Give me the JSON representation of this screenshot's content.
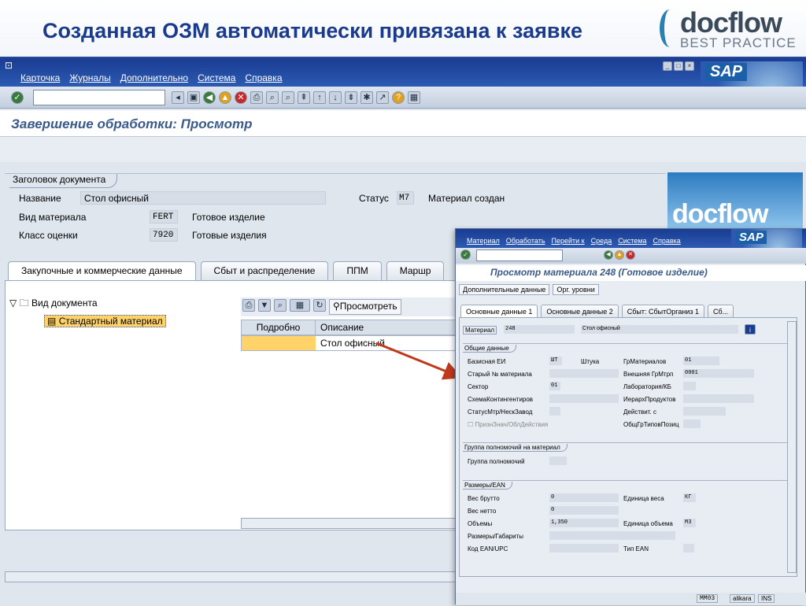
{
  "slide": {
    "title": "Созданная ОЗМ автоматически привязана к заявке",
    "logo_word": "docflow",
    "logo_sub": "BEST PRACTICE"
  },
  "sap": {
    "menu": [
      "Карточка",
      "Журналы",
      "Дополнительно",
      "Система",
      "Справка"
    ],
    "title": "Завершение обработки: Просмотр",
    "header_group": "Заголовок документа",
    "name_label": "Название",
    "name_value": "Стол офисный",
    "status_label": "Статус",
    "status_code": "M7",
    "status_text": "Материал создан",
    "type_label": "Вид материала",
    "type_code": "FERT",
    "type_text": "Готовое изделие",
    "class_label": "Класс оценки",
    "class_code": "7920",
    "class_text": "Готовые изделия",
    "docflow_img": "docflow",
    "tabs": [
      "Закупочные и коммерческие данные",
      "Сбыт и распределение",
      "ППМ",
      "Маршр"
    ],
    "tree_root": "Вид документа",
    "tree_child": "Стандартный материал",
    "alv_view": "Просмотреть",
    "alv_cols": [
      "Подробно",
      "Описание"
    ],
    "alv_row_desc": "Стол офисный"
  },
  "popup": {
    "menu": [
      "Материал",
      "Обработать",
      "Перейти к",
      "Среда",
      "Система",
      "Справка"
    ],
    "title": "Просмотр материала 248 (Готовое изделие)",
    "btn_more": "Дополнительные данные",
    "btn_org": "Орг. уровни",
    "tabs": [
      "Основные данные 1",
      "Основные данные 2",
      "Сбыт: СбытОрганиз 1",
      "Сб..."
    ],
    "material_label": "Материал",
    "material_num": "248",
    "material_desc": "Стол офисный",
    "g1": "Общие данные",
    "base_uom_l": "Базисная ЕИ",
    "base_uom": "ШТ",
    "base_uom_t": "Штука",
    "matgrp_l": "ГрМатериалов",
    "matgrp": "01",
    "old_l": "Старый № материала",
    "ext_l": "Внешняя ГрМтрп",
    "ext": "0001",
    "sector_l": "Сектор",
    "sector": "01",
    "lab_l": "Лаборатория/КБ",
    "scheme_l": "СхемаКонтингентиров",
    "hier_l": "ИерархПродуктов",
    "status_l": "СтатусМтр/НескЗавод",
    "valid_l": "Действит. с",
    "flag_l": "ПризнЗнач/ОблДействия",
    "gen_l": "ОбщГрТиповПозиц",
    "g2": "Группа полномочий на материал",
    "auth_l": "Группа полномочий",
    "g3": "Размеры/EAN",
    "gross_l": "Вес брутто",
    "gross": "0",
    "wunit_l": "Единица веса",
    "wunit": "КГ",
    "net_l": "Вес нетто",
    "net": "0",
    "vol_l": "Объемы",
    "vol": "1,350",
    "vunit_l": "Единица объема",
    "vunit": "М3",
    "dim_l": "Размеры/Габариты",
    "ean_l": "Код EAN/UPC",
    "eantype_l": "Тип EAN",
    "status_tx": "MM03",
    "user": "alikara",
    "mode": "INS"
  }
}
